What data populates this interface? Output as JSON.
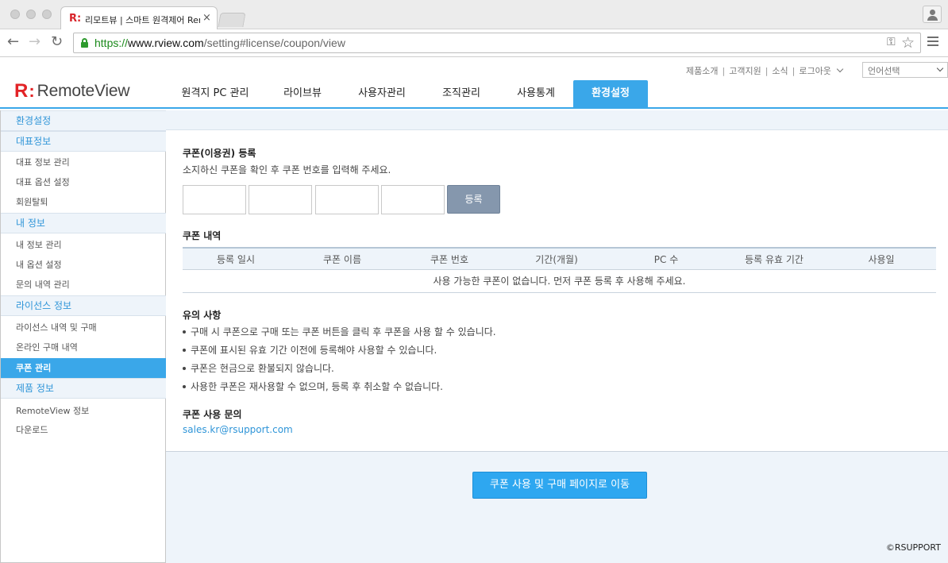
{
  "browser": {
    "tab_title": "리모트뷰 | 스마트 원격제어 Remo",
    "tab_close": "×",
    "favicon": "R:",
    "url_scheme": "https://",
    "url_host": "www.rview.com",
    "url_path": "/setting#license/coupon/view",
    "back_glyph": "←",
    "forward_glyph": "→",
    "reload_glyph": "↻",
    "key_glyph": "⚿",
    "star_glyph": "☆"
  },
  "header": {
    "logo_r": "R",
    "logo_colon": ":",
    "logo_text": "RemoteView",
    "util_links": [
      "제품소개",
      "고객지원",
      "소식",
      "로그아웃"
    ],
    "util_separator": "|",
    "language_select": "언어선택",
    "nav": [
      {
        "label": "원격지 PC 관리"
      },
      {
        "label": "라이브뷰"
      },
      {
        "label": "사용자관리"
      },
      {
        "label": "조직관리"
      },
      {
        "label": "사용통계"
      },
      {
        "label": "환경설정",
        "active": true
      }
    ]
  },
  "sidebar": {
    "sections": [
      {
        "title": "환경설정",
        "items": []
      },
      {
        "title": "대표정보",
        "items": [
          "대표 정보 관리",
          "대표 옵션 설정",
          "회원탈퇴"
        ]
      },
      {
        "title": "내 정보",
        "items": [
          "내 정보 관리",
          "내 옵션 설정",
          "문의 내역 관리"
        ]
      },
      {
        "title": "라이선스 정보",
        "items": [
          "라이선스 내역 및 구매",
          "온라인 구매 내역",
          "쿠폰 관리"
        ]
      },
      {
        "title": "제품 정보",
        "items": [
          "RemoteView 정보",
          "다운로드"
        ]
      }
    ],
    "active_item": "쿠폰 관리"
  },
  "main": {
    "register_title": "쿠폰(이용권) 등록",
    "register_desc": "소지하신 쿠폰을 확인 후 쿠폰 번호를 입력해 주세요.",
    "register_button": "등록",
    "history_title": "쿠폰 내역",
    "table_headers": [
      "등록 일시",
      "쿠폰 이름",
      "쿠폰 번호",
      "기간(개월)",
      "PC 수",
      "등록 유효 기간",
      "사용일"
    ],
    "table_empty": "사용 가능한 쿠폰이 없습니다. 먼저 쿠폰 등록 후 사용해 주세요.",
    "notes_title": "유의 사항",
    "notes": [
      "구매 시 쿠폰으로 구매 또는 쿠폰 버튼을 클릭 후 쿠폰을 사용 할 수 있습니다.",
      "쿠폰에 표시된 유효 기간 이전에 등록해야 사용할 수 있습니다.",
      "쿠폰은 현금으로 환불되지 않습니다.",
      "사용한 쿠폰은 재사용할 수 없으며, 등록 후 취소할 수 없습니다."
    ],
    "inquiry_title": "쿠폰 사용 문의",
    "inquiry_email": "sales.kr@rsupport.com"
  },
  "footer": {
    "cta_button": "쿠폰 사용 및 구매 페이지로 이동",
    "copyright": "©RSUPPORT"
  },
  "colors": {
    "accent": "#3aa7e9",
    "cta": "#2ea7f0",
    "register_button": "#8597ad",
    "logo_red": "#e22326",
    "panel_bg": "#eef4fa"
  }
}
